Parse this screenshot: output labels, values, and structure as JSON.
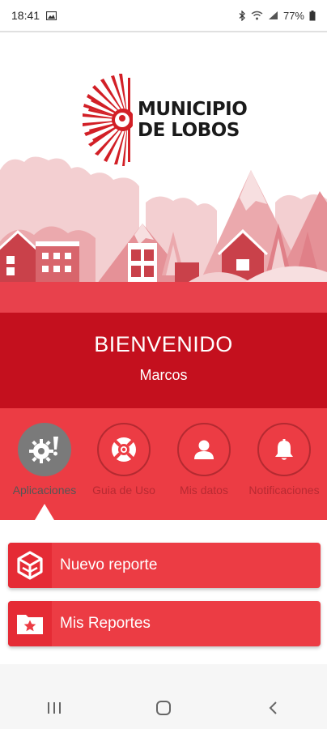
{
  "status_bar": {
    "time": "18:41",
    "battery": "77%",
    "icons": [
      "image-icon",
      "bluetooth-icon",
      "wifi-icon",
      "signal-icon",
      "battery-icon"
    ]
  },
  "logo": {
    "line1": "MUNICIPIO",
    "line2": "DE LOBOS",
    "color": "#d21f26"
  },
  "welcome": {
    "title": "BIENVENIDO",
    "user": "Marcos"
  },
  "tabs": [
    {
      "label": "Aplicaciones",
      "icon": "gear-icon",
      "active": true
    },
    {
      "label": "Guia de Uso",
      "icon": "lifebuoy-icon",
      "active": false
    },
    {
      "label": "Mis datos",
      "icon": "user-icon",
      "active": false
    },
    {
      "label": "Notificaciones",
      "icon": "bell-icon",
      "active": false
    }
  ],
  "actions": [
    {
      "label": "Nuevo reporte",
      "icon": "new-report-icon"
    },
    {
      "label": "Mis Reportes",
      "icon": "folder-star-icon"
    }
  ],
  "nav": {
    "buttons": [
      "recent-apps-icon",
      "home-icon",
      "back-icon"
    ]
  },
  "colors": {
    "primary_red": "#ec3c44",
    "dark_red": "#c4101e",
    "inactive_tab_text": "#b82a32"
  }
}
